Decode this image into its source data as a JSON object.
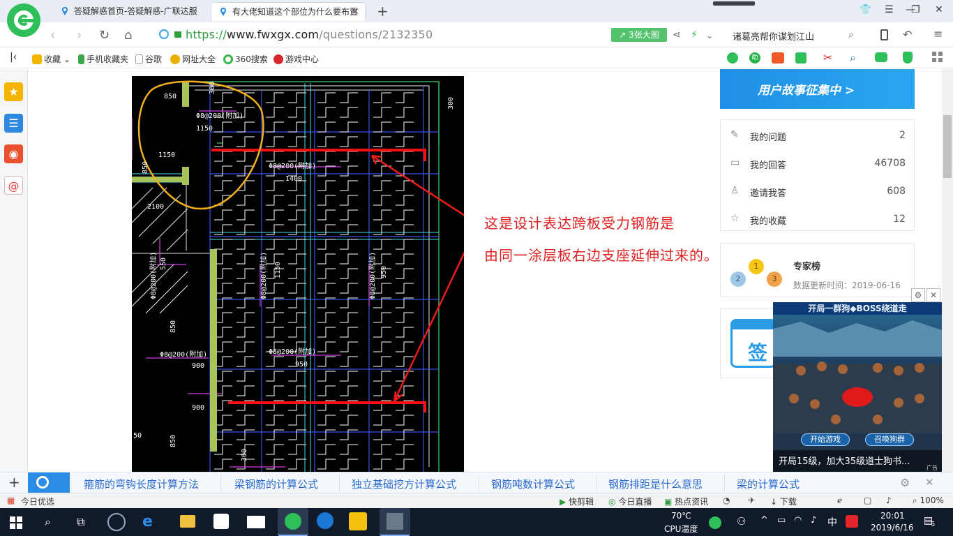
{
  "browser": {
    "tabs": [
      {
        "title": "答疑解惑首页-答疑解惑-广联达服",
        "active": false
      },
      {
        "title": "有大佬知道这个部位为什么要布置",
        "active": true
      }
    ],
    "url": {
      "scheme": "https://",
      "host": "www.fwxgx.com",
      "path": "/questions/2132350"
    },
    "big_image_button": "3张大图",
    "search_text": "诸葛亮帮你谋划江山"
  },
  "bookmarks": [
    {
      "label": "收藏",
      "icon": "star-icon"
    },
    {
      "label": "手机收藏夹",
      "icon": "phone-icon"
    },
    {
      "label": "谷歌",
      "icon": "page-icon"
    },
    {
      "label": "网址大全",
      "icon": "sites-icon"
    },
    {
      "label": "360搜索",
      "icon": "search360-icon"
    },
    {
      "label": "游戏中心",
      "icon": "game-icon"
    }
  ],
  "drawing": {
    "labels": [
      {
        "text": "850"
      },
      {
        "text": "Φ8@200(附加)"
      },
      {
        "text": "1150"
      },
      {
        "text": "1150"
      },
      {
        "text": "850"
      },
      {
        "text": "Φ8@200(附加)"
      },
      {
        "text": "1400"
      },
      {
        "text": "2100"
      },
      {
        "text": "Φ8@200(附加)"
      },
      {
        "text": "550"
      },
      {
        "text": "Φ8@200(附加)"
      },
      {
        "text": "1150"
      },
      {
        "text": "Φ8@200(附加)"
      },
      {
        "text": "950"
      },
      {
        "text": "850"
      },
      {
        "text": "Φ8@200(附加)"
      },
      {
        "text": "900"
      },
      {
        "text": "Φ8@200(附加)"
      },
      {
        "text": "950"
      },
      {
        "text": "900"
      },
      {
        "text": "850"
      },
      {
        "text": "300"
      },
      {
        "text": "50"
      },
      {
        "text": "300"
      },
      {
        "text": "300"
      }
    ]
  },
  "annotation": {
    "line1": "这是设计表达跨板受力钢筋是",
    "line2": "由同一涂层板右边支座延伸过来的。"
  },
  "right_panel": {
    "banner_text": "用户故事征集中 >",
    "stats": [
      {
        "label": "我的问题",
        "value": "2",
        "icon": "question-icon"
      },
      {
        "label": "我的回答",
        "value": "46708",
        "icon": "comment-icon"
      },
      {
        "label": "邀请我答",
        "value": "608",
        "icon": "user-icon"
      },
      {
        "label": "我的收藏",
        "value": "12",
        "icon": "star-outline-icon"
      }
    ],
    "expert": {
      "title": "专家榜",
      "updated": "数据更新时间：2019-06-16",
      "medals": [
        "1",
        "2",
        "3"
      ]
    },
    "checkin_label": "签"
  },
  "game_ad": {
    "header": "开局一群狗◆BOSS绕道走",
    "start_button": "开始游戏",
    "summon_button": "召唤狗群",
    "caption": "开局15级，加大35级道士狗书...",
    "tag": "广告"
  },
  "related_searches": [
    "箍筋的弯钩长度计算方法",
    "梁钢筋的计算公式",
    "独立基础挖方计算公式",
    "钢筋吨数计算公式",
    "钢筋排距是什么意思",
    "梁的计算公式"
  ],
  "statusbar": {
    "left": "今日优选",
    "items": [
      "快剪辑",
      "今日直播",
      "热点资讯",
      "下载"
    ],
    "zoom": "100%"
  },
  "taskbar": {
    "cpu_temp": "70℃",
    "cpu_label": "CPU温度",
    "ime": "中",
    "time": "20:01",
    "date": "2019/6/16",
    "notifications": "5"
  }
}
